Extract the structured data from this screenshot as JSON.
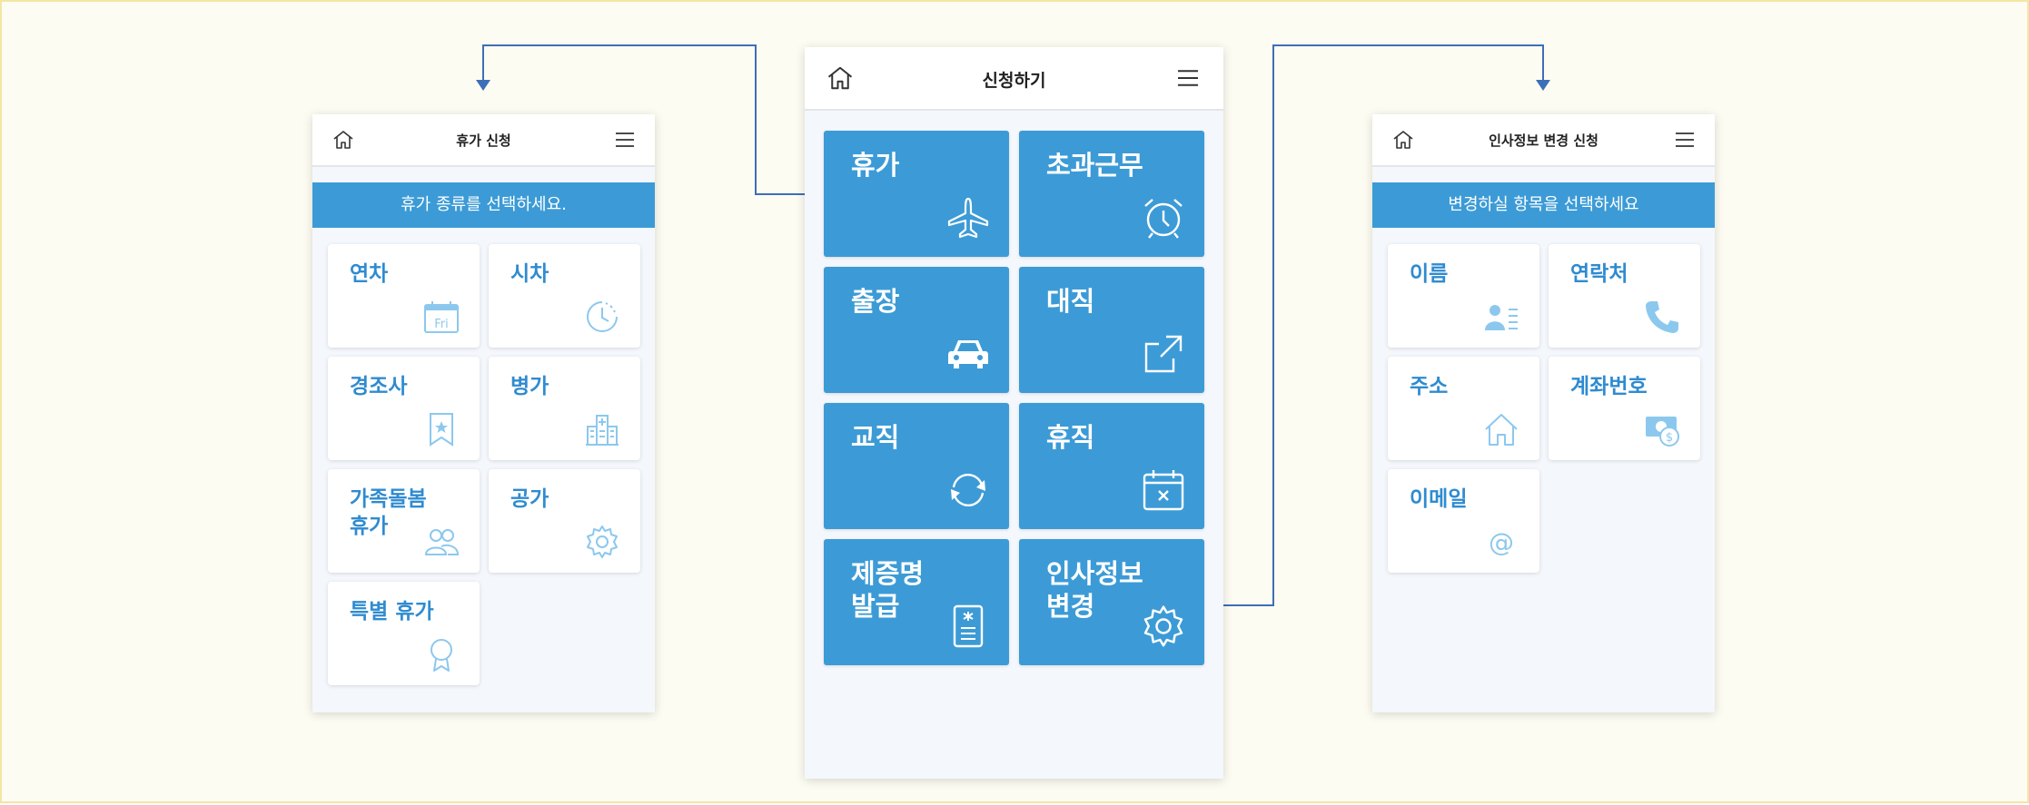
{
  "left_screen": {
    "title": "휴가 신청",
    "banner": "휴가 종류를 선택하세요.",
    "items": [
      {
        "lines": [
          "연차"
        ],
        "icon": "calendar-fri-icon",
        "icon_text": "Fri"
      },
      {
        "lines": [
          "시차"
        ],
        "icon": "clock-icon"
      },
      {
        "lines": [
          "경조사"
        ],
        "icon": "bookmark-icon"
      },
      {
        "lines": [
          "병가"
        ],
        "icon": "hospital-icon"
      },
      {
        "lines": [
          "가족돌봄",
          "휴가"
        ],
        "icon": "people-icon"
      },
      {
        "lines": [
          "공가"
        ],
        "icon": "gear-icon"
      },
      {
        "lines": [
          "특별 휴가"
        ],
        "icon": "award-icon"
      }
    ]
  },
  "center_screen": {
    "title": "신청하기",
    "items": [
      {
        "lines": [
          "휴가"
        ],
        "icon": "airplane-icon"
      },
      {
        "lines": [
          "초과근무"
        ],
        "icon": "alarm-clock-icon"
      },
      {
        "lines": [
          "출장"
        ],
        "icon": "car-icon"
      },
      {
        "lines": [
          "대직"
        ],
        "icon": "arrow-out-icon"
      },
      {
        "lines": [
          "교직"
        ],
        "icon": "refresh-icon"
      },
      {
        "lines": [
          "휴직"
        ],
        "icon": "calendar-x-icon"
      },
      {
        "lines": [
          "제증명",
          "발급"
        ],
        "icon": "document-icon"
      },
      {
        "lines": [
          "인사정보",
          "변경"
        ],
        "icon": "gear-icon"
      }
    ]
  },
  "right_screen": {
    "title": "인사정보 변경 신청",
    "banner": "변경하실 항목을 선택하세요",
    "items": [
      {
        "lines": [
          "이름"
        ],
        "icon": "contact-card-icon"
      },
      {
        "lines": [
          "연락처"
        ],
        "icon": "phone-icon"
      },
      {
        "lines": [
          "주소"
        ],
        "icon": "house-icon"
      },
      {
        "lines": [
          "계좌번호"
        ],
        "icon": "money-icon",
        "icon_text": "$"
      },
      {
        "lines": [
          "이메일"
        ],
        "icon": "at-icon",
        "icon_text": "@"
      }
    ]
  },
  "colors": {
    "accent": "#3c9bd6",
    "label_blue": "#2f8bd0",
    "icon_light": "#8cc8ee",
    "connector": "#3d6fb8",
    "background": "#fdfcf2",
    "border": "#f3e6a6"
  }
}
